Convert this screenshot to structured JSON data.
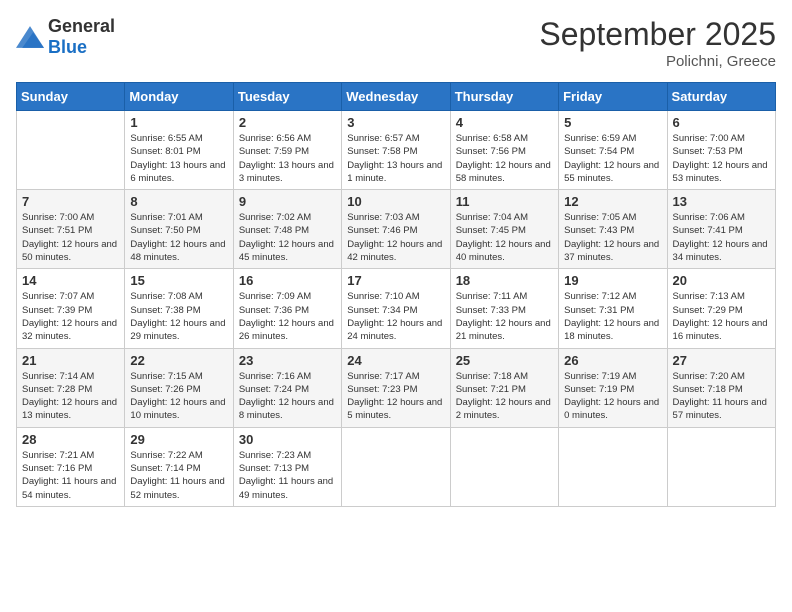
{
  "header": {
    "logo_general": "General",
    "logo_blue": "Blue",
    "month_title": "September 2025",
    "location": "Polichni, Greece"
  },
  "days_of_week": [
    "Sunday",
    "Monday",
    "Tuesday",
    "Wednesday",
    "Thursday",
    "Friday",
    "Saturday"
  ],
  "weeks": [
    [
      {
        "day": "",
        "sunrise": "",
        "sunset": "",
        "daylight": ""
      },
      {
        "day": "1",
        "sunrise": "Sunrise: 6:55 AM",
        "sunset": "Sunset: 8:01 PM",
        "daylight": "Daylight: 13 hours and 6 minutes."
      },
      {
        "day": "2",
        "sunrise": "Sunrise: 6:56 AM",
        "sunset": "Sunset: 7:59 PM",
        "daylight": "Daylight: 13 hours and 3 minutes."
      },
      {
        "day": "3",
        "sunrise": "Sunrise: 6:57 AM",
        "sunset": "Sunset: 7:58 PM",
        "daylight": "Daylight: 13 hours and 1 minute."
      },
      {
        "day": "4",
        "sunrise": "Sunrise: 6:58 AM",
        "sunset": "Sunset: 7:56 PM",
        "daylight": "Daylight: 12 hours and 58 minutes."
      },
      {
        "day": "5",
        "sunrise": "Sunrise: 6:59 AM",
        "sunset": "Sunset: 7:54 PM",
        "daylight": "Daylight: 12 hours and 55 minutes."
      },
      {
        "day": "6",
        "sunrise": "Sunrise: 7:00 AM",
        "sunset": "Sunset: 7:53 PM",
        "daylight": "Daylight: 12 hours and 53 minutes."
      }
    ],
    [
      {
        "day": "7",
        "sunrise": "Sunrise: 7:00 AM",
        "sunset": "Sunset: 7:51 PM",
        "daylight": "Daylight: 12 hours and 50 minutes."
      },
      {
        "day": "8",
        "sunrise": "Sunrise: 7:01 AM",
        "sunset": "Sunset: 7:50 PM",
        "daylight": "Daylight: 12 hours and 48 minutes."
      },
      {
        "day": "9",
        "sunrise": "Sunrise: 7:02 AM",
        "sunset": "Sunset: 7:48 PM",
        "daylight": "Daylight: 12 hours and 45 minutes."
      },
      {
        "day": "10",
        "sunrise": "Sunrise: 7:03 AM",
        "sunset": "Sunset: 7:46 PM",
        "daylight": "Daylight: 12 hours and 42 minutes."
      },
      {
        "day": "11",
        "sunrise": "Sunrise: 7:04 AM",
        "sunset": "Sunset: 7:45 PM",
        "daylight": "Daylight: 12 hours and 40 minutes."
      },
      {
        "day": "12",
        "sunrise": "Sunrise: 7:05 AM",
        "sunset": "Sunset: 7:43 PM",
        "daylight": "Daylight: 12 hours and 37 minutes."
      },
      {
        "day": "13",
        "sunrise": "Sunrise: 7:06 AM",
        "sunset": "Sunset: 7:41 PM",
        "daylight": "Daylight: 12 hours and 34 minutes."
      }
    ],
    [
      {
        "day": "14",
        "sunrise": "Sunrise: 7:07 AM",
        "sunset": "Sunset: 7:39 PM",
        "daylight": "Daylight: 12 hours and 32 minutes."
      },
      {
        "day": "15",
        "sunrise": "Sunrise: 7:08 AM",
        "sunset": "Sunset: 7:38 PM",
        "daylight": "Daylight: 12 hours and 29 minutes."
      },
      {
        "day": "16",
        "sunrise": "Sunrise: 7:09 AM",
        "sunset": "Sunset: 7:36 PM",
        "daylight": "Daylight: 12 hours and 26 minutes."
      },
      {
        "day": "17",
        "sunrise": "Sunrise: 7:10 AM",
        "sunset": "Sunset: 7:34 PM",
        "daylight": "Daylight: 12 hours and 24 minutes."
      },
      {
        "day": "18",
        "sunrise": "Sunrise: 7:11 AM",
        "sunset": "Sunset: 7:33 PM",
        "daylight": "Daylight: 12 hours and 21 minutes."
      },
      {
        "day": "19",
        "sunrise": "Sunrise: 7:12 AM",
        "sunset": "Sunset: 7:31 PM",
        "daylight": "Daylight: 12 hours and 18 minutes."
      },
      {
        "day": "20",
        "sunrise": "Sunrise: 7:13 AM",
        "sunset": "Sunset: 7:29 PM",
        "daylight": "Daylight: 12 hours and 16 minutes."
      }
    ],
    [
      {
        "day": "21",
        "sunrise": "Sunrise: 7:14 AM",
        "sunset": "Sunset: 7:28 PM",
        "daylight": "Daylight: 12 hours and 13 minutes."
      },
      {
        "day": "22",
        "sunrise": "Sunrise: 7:15 AM",
        "sunset": "Sunset: 7:26 PM",
        "daylight": "Daylight: 12 hours and 10 minutes."
      },
      {
        "day": "23",
        "sunrise": "Sunrise: 7:16 AM",
        "sunset": "Sunset: 7:24 PM",
        "daylight": "Daylight: 12 hours and 8 minutes."
      },
      {
        "day": "24",
        "sunrise": "Sunrise: 7:17 AM",
        "sunset": "Sunset: 7:23 PM",
        "daylight": "Daylight: 12 hours and 5 minutes."
      },
      {
        "day": "25",
        "sunrise": "Sunrise: 7:18 AM",
        "sunset": "Sunset: 7:21 PM",
        "daylight": "Daylight: 12 hours and 2 minutes."
      },
      {
        "day": "26",
        "sunrise": "Sunrise: 7:19 AM",
        "sunset": "Sunset: 7:19 PM",
        "daylight": "Daylight: 12 hours and 0 minutes."
      },
      {
        "day": "27",
        "sunrise": "Sunrise: 7:20 AM",
        "sunset": "Sunset: 7:18 PM",
        "daylight": "Daylight: 11 hours and 57 minutes."
      }
    ],
    [
      {
        "day": "28",
        "sunrise": "Sunrise: 7:21 AM",
        "sunset": "Sunset: 7:16 PM",
        "daylight": "Daylight: 11 hours and 54 minutes."
      },
      {
        "day": "29",
        "sunrise": "Sunrise: 7:22 AM",
        "sunset": "Sunset: 7:14 PM",
        "daylight": "Daylight: 11 hours and 52 minutes."
      },
      {
        "day": "30",
        "sunrise": "Sunrise: 7:23 AM",
        "sunset": "Sunset: 7:13 PM",
        "daylight": "Daylight: 11 hours and 49 minutes."
      },
      {
        "day": "",
        "sunrise": "",
        "sunset": "",
        "daylight": ""
      },
      {
        "day": "",
        "sunrise": "",
        "sunset": "",
        "daylight": ""
      },
      {
        "day": "",
        "sunrise": "",
        "sunset": "",
        "daylight": ""
      },
      {
        "day": "",
        "sunrise": "",
        "sunset": "",
        "daylight": ""
      }
    ]
  ]
}
